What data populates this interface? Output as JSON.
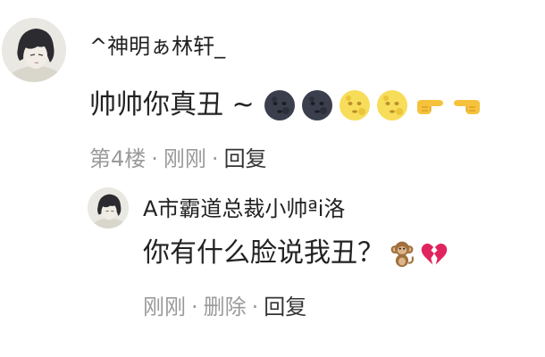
{
  "main_comment": {
    "username": "^神明ぁ林轩_",
    "text": "帅帅你真丑 ~",
    "emojis": [
      "new-moon-face-icon",
      "new-moon-face-icon",
      "full-moon-face-icon",
      "full-moon-face-icon",
      "pointing-right-icon",
      "pointing-left-icon"
    ],
    "floor": "第4楼",
    "time": "刚刚",
    "reply_label": "回复",
    "separator": "·"
  },
  "reply_comment": {
    "username": "A市霸道总裁小帅ªi洛",
    "text": "你有什么脸说我丑？",
    "emojis": [
      "monkey-icon",
      "broken-heart-icon"
    ],
    "time": "刚刚",
    "delete_label": "删除",
    "reply_label": "回复",
    "separator": "·"
  }
}
